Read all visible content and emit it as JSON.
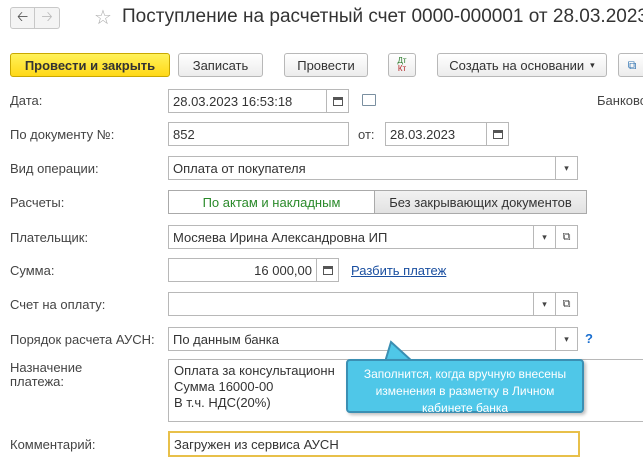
{
  "header": {
    "back_icon": "arrow-left-icon",
    "forward_icon": "arrow-right-icon",
    "star_icon": "star-icon",
    "title": "Поступление на расчетный счет 0000-000001 от 28.03.2023"
  },
  "toolbar": {
    "post_and_close": "Провести и закрыть",
    "save": "Записать",
    "post": "Провести",
    "dt_kt_top": "Дт",
    "dt_kt_bottom": "Кт",
    "create_based_on": "Создать на основании",
    "create_based_on_arrow": "▾"
  },
  "form": {
    "date_label": "Дата:",
    "date_value": "28.03.2023 16:53:18",
    "bank_label": "Банковс",
    "doc_label": "По документу №:",
    "doc_number": "852",
    "from_label": "от:",
    "doc_date": "28.03.2023",
    "operation_label": "Вид операции:",
    "operation_value": "Оплата от покупателя",
    "settlements_label": "Расчеты:",
    "settlements_options": [
      "По актам и накладным",
      "Без закрывающих документов"
    ],
    "payer_label": "Плательщик:",
    "payer_value": "Мосяева Ирина Александровна ИП",
    "amount_label": "Сумма:",
    "amount_value": "16 000,00",
    "split_link": "Разбить платеж",
    "invoice_label": "Счет на оплату:",
    "invoice_value": "",
    "ausn_label": "Порядок расчета АУСН:",
    "ausn_value": "По данным банка",
    "help": "?",
    "purpose_label_line1": "Назначение",
    "purpose_label_line2": "платежа:",
    "purpose_lines": [
      "Оплата за консультационн",
      "Сумма 16000-00",
      "В т.ч. НДС(20%)"
    ],
    "comment_label": "Комментарий:",
    "comment_value": "Загружен из сервиса АУСН"
  },
  "tooltip": {
    "text": "Заполнится, когда вручную внесены изменения в разметку в Личном кабинете банка"
  },
  "colors": {
    "primary_button": "#ffd817",
    "tooltip_bg": "#4fc7e8",
    "link": "#1a4fa0",
    "active_toggle_text": "#2a8a2a",
    "comment_border": "#e8c04a"
  }
}
